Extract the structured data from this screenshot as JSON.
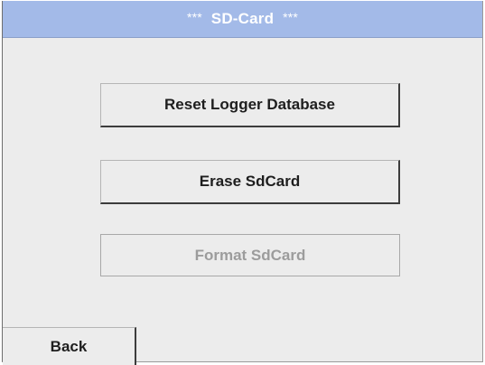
{
  "header": {
    "stars_left": "***",
    "title": "SD-Card",
    "stars_right": "***"
  },
  "actions": {
    "reset_label": "Reset Logger Database",
    "erase_label": "Erase SdCard",
    "format_label": "Format SdCard",
    "format_enabled": false
  },
  "footer": {
    "back_label": "Back"
  },
  "colors": {
    "header_background": "#a3bae8",
    "screen_background": "#ececec",
    "disabled_text": "#9c9c9c"
  }
}
